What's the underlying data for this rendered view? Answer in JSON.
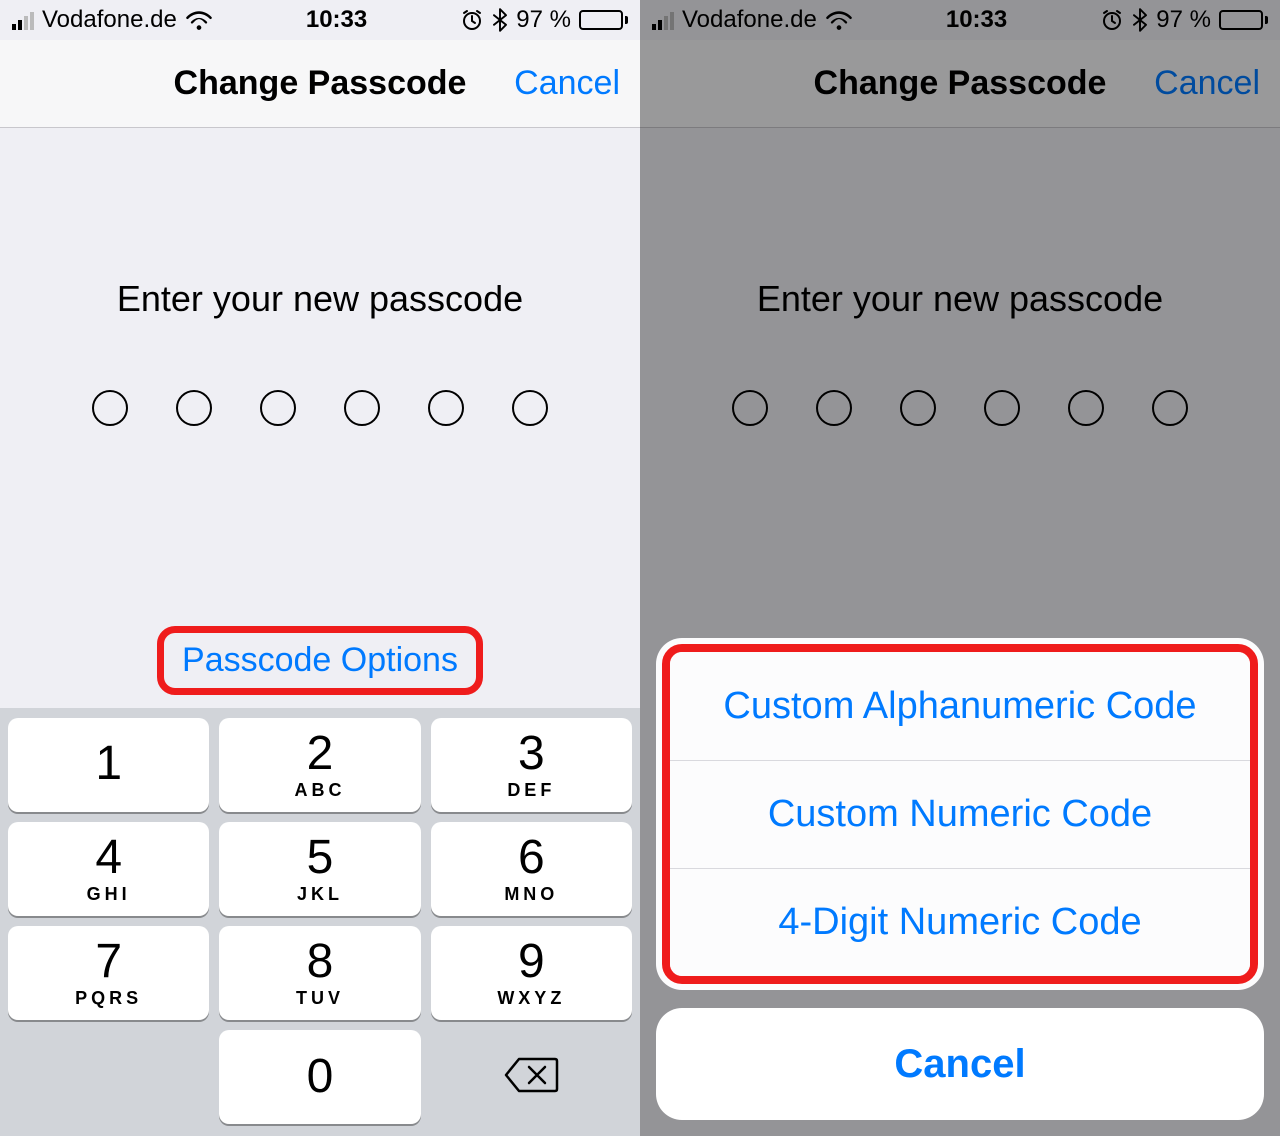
{
  "status": {
    "carrier": "Vodafone.de",
    "time": "10:33",
    "battery_pct": "97 %"
  },
  "nav": {
    "title": "Change Passcode",
    "cancel": "Cancel"
  },
  "prompt": {
    "text": "Enter your new passcode",
    "passcode_options": "Passcode Options"
  },
  "keypad": {
    "keys": [
      {
        "digit": "1",
        "letters": ""
      },
      {
        "digit": "2",
        "letters": "ABC"
      },
      {
        "digit": "3",
        "letters": "DEF"
      },
      {
        "digit": "4",
        "letters": "GHI"
      },
      {
        "digit": "5",
        "letters": "JKL"
      },
      {
        "digit": "6",
        "letters": "MNO"
      },
      {
        "digit": "7",
        "letters": "PQRS"
      },
      {
        "digit": "8",
        "letters": "TUV"
      },
      {
        "digit": "9",
        "letters": "WXYZ"
      },
      {
        "digit": "0",
        "letters": ""
      }
    ]
  },
  "sheet": {
    "options": [
      "Custom Alphanumeric Code",
      "Custom Numeric Code",
      "4-Digit Numeric Code"
    ],
    "cancel": "Cancel"
  },
  "colors": {
    "ios_blue": "#007aff",
    "highlight_red": "#ef1c1c"
  }
}
